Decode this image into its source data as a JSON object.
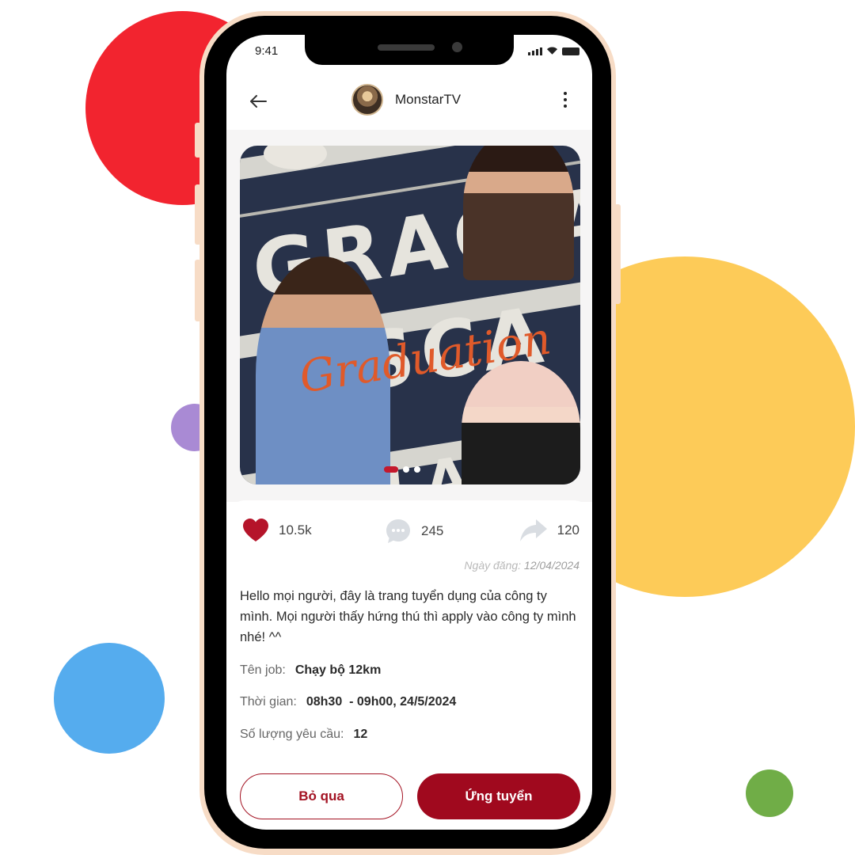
{
  "status_bar": {
    "time": "9:41"
  },
  "header": {
    "username": "MonstarTV"
  },
  "post": {
    "image_words": [
      "GRACIA",
      "CISCA",
      "ENLA"
    ],
    "image_script": "Graduation",
    "likes": "10.5k",
    "comments": "245",
    "shares": "120",
    "date_label": "Ngày đăng:",
    "date_value": "12/04/2024",
    "text": "Hello mọi người, đây là trang tuyển dụng của công ty mình. Mọi người thấy hứng thú thì apply vào công ty mình nhé! ^^",
    "fields": [
      {
        "label": "Tên job:",
        "value": "Chạy bộ 12km"
      },
      {
        "label": "Thời gian:",
        "value": "08h30  - 09h00, 24/5/2024"
      },
      {
        "label": "Số lượng yêu cầu:",
        "value": "12"
      }
    ]
  },
  "actions": {
    "skip_label": "Bỏ qua",
    "apply_label": "Ứng tuyển"
  },
  "colors": {
    "accent": "#a0091e",
    "like": "#c4192d",
    "red_circle": "#f2242f",
    "yellow_circle": "#fdcb58",
    "blue_circle": "#55acee"
  }
}
